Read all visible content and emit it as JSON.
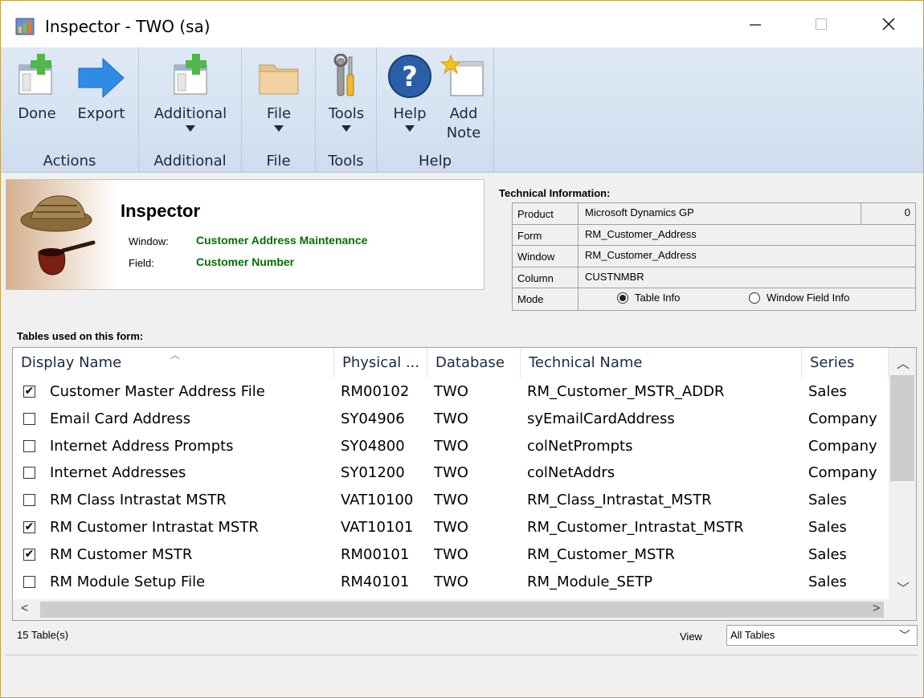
{
  "window": {
    "title": "Inspector  -  TWO (sa)",
    "minimize_icon": "minimize-icon",
    "maximize_icon": "maximize-icon",
    "close_icon": "close-icon"
  },
  "ribbon": {
    "groups": [
      {
        "label": "Actions",
        "buttons": [
          {
            "label": "Done",
            "icon": "done-icon"
          },
          {
            "label": "Export",
            "icon": "export-arrow-icon"
          }
        ]
      },
      {
        "label": "Additional",
        "buttons": [
          {
            "label": "Additional",
            "icon": "additional-icon"
          }
        ]
      },
      {
        "label": "File",
        "buttons": [
          {
            "label": "File",
            "icon": "folder-icon"
          }
        ]
      },
      {
        "label": "Tools",
        "buttons": [
          {
            "label": "Tools",
            "icon": "tools-icon"
          }
        ]
      },
      {
        "label": "Help",
        "buttons": [
          {
            "label": "Help",
            "icon": "help-icon"
          },
          {
            "label": "Add",
            "label2": "Note",
            "icon": "add-note-icon"
          }
        ]
      }
    ]
  },
  "inspector": {
    "title": "Inspector",
    "window_label": "Window:",
    "window_value": "Customer Address Maintenance",
    "field_label": "Field:",
    "field_value": "Customer Number"
  },
  "technical": {
    "title": "Technical Information:",
    "rows": [
      {
        "key": "Product",
        "value": "Microsoft Dynamics GP",
        "extra": "0"
      },
      {
        "key": "Form",
        "value": "RM_Customer_Address"
      },
      {
        "key": "Window",
        "value": "RM_Customer_Address"
      },
      {
        "key": "Column",
        "value": "CUSTNMBR"
      }
    ],
    "mode_label": "Mode",
    "mode_options": [
      "Table Info",
      "Window Field Info"
    ],
    "mode_selected": "Table Info"
  },
  "tables": {
    "label": "Tables used on this form:",
    "columns": [
      "Display Name",
      "Physical ...",
      "Database",
      "Technical Name",
      "Series"
    ],
    "rows": [
      {
        "checked": true,
        "display": "Customer Master Address File",
        "physical": "RM00102",
        "db": "TWO",
        "tech": "RM_Customer_MSTR_ADDR",
        "series": "Sales"
      },
      {
        "checked": false,
        "display": "Email Card Address",
        "physical": "SY04906",
        "db": "TWO",
        "tech": "syEmailCardAddress",
        "series": "Company"
      },
      {
        "checked": false,
        "display": "Internet Address Prompts",
        "physical": "SY04800",
        "db": "TWO",
        "tech": "colNetPrompts",
        "series": "Company"
      },
      {
        "checked": false,
        "display": "Internet Addresses",
        "physical": "SY01200",
        "db": "TWO",
        "tech": "colNetAddrs",
        "series": "Company"
      },
      {
        "checked": false,
        "display": "RM Class Intrastat MSTR",
        "physical": "VAT10100",
        "db": "TWO",
        "tech": "RM_Class_Intrastat_MSTR",
        "series": "Sales"
      },
      {
        "checked": true,
        "display": "RM Customer Intrastat MSTR",
        "physical": "VAT10101",
        "db": "TWO",
        "tech": "RM_Customer_Intrastat_MSTR",
        "series": "Sales"
      },
      {
        "checked": true,
        "display": "RM Customer MSTR",
        "physical": "RM00101",
        "db": "TWO",
        "tech": "RM_Customer_MSTR",
        "series": "Sales"
      },
      {
        "checked": false,
        "display": "RM Module Setup File",
        "physical": "RM40101",
        "db": "TWO",
        "tech": "RM_Module_SETP",
        "series": "Sales"
      }
    ],
    "count_text": "15 Table(s)"
  },
  "view": {
    "label": "View",
    "selected": "All Tables"
  }
}
